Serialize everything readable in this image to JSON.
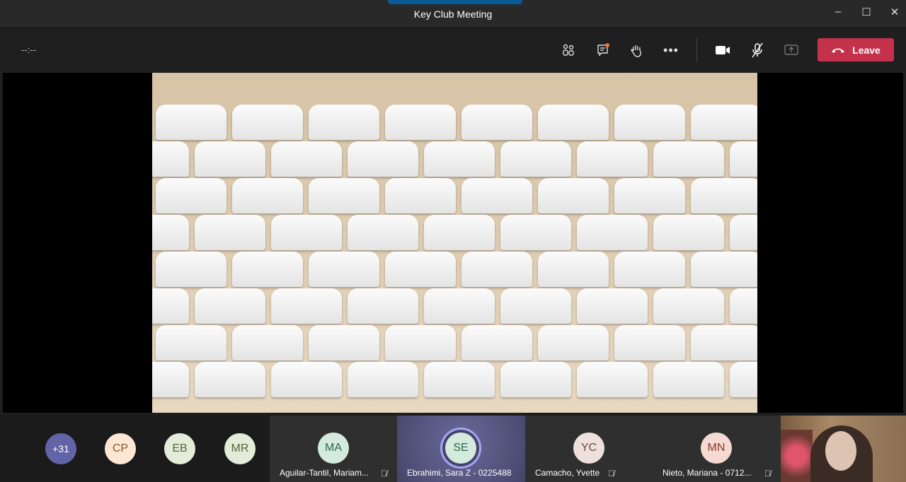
{
  "window": {
    "title": "Key Club Meeting",
    "minimize": "–",
    "maximize": "☐",
    "close": "✕"
  },
  "toolbar": {
    "timer": "--:--",
    "leave_label": "Leave",
    "chat_badge_color": "#e97548",
    "leave_color": "#c4314b"
  },
  "participants_overflow": "+31",
  "avatars": [
    {
      "initials": "CP",
      "bg": "#fde7d4",
      "fg": "#8a5a2b"
    },
    {
      "initials": "EB",
      "bg": "#e3ecd9",
      "fg": "#4f6b3a"
    },
    {
      "initials": "MR",
      "bg": "#e3ecd9",
      "fg": "#4f6b3a"
    }
  ],
  "tiles": [
    {
      "initials": "MA",
      "name": "Aguilar-Tantil, Mariam...",
      "bg": "#d3eadc",
      "fg": "#2e6a49",
      "muted": true
    },
    {
      "initials": "SE",
      "name": "Ebrahimi, Sara Z - 0225488",
      "bg": "#d3eadc",
      "fg": "#2e6a49",
      "muted": false,
      "speaking": true
    },
    {
      "initials": "YC",
      "name": "Camacho, Yvette",
      "bg": "#eee0dc",
      "fg": "#6b4a40",
      "muted": true
    },
    {
      "initials": "MN",
      "name": "Nieto, Mariana - 0712...",
      "bg": "#f5d9d2",
      "fg": "#8a3a2a",
      "muted": true
    }
  ]
}
